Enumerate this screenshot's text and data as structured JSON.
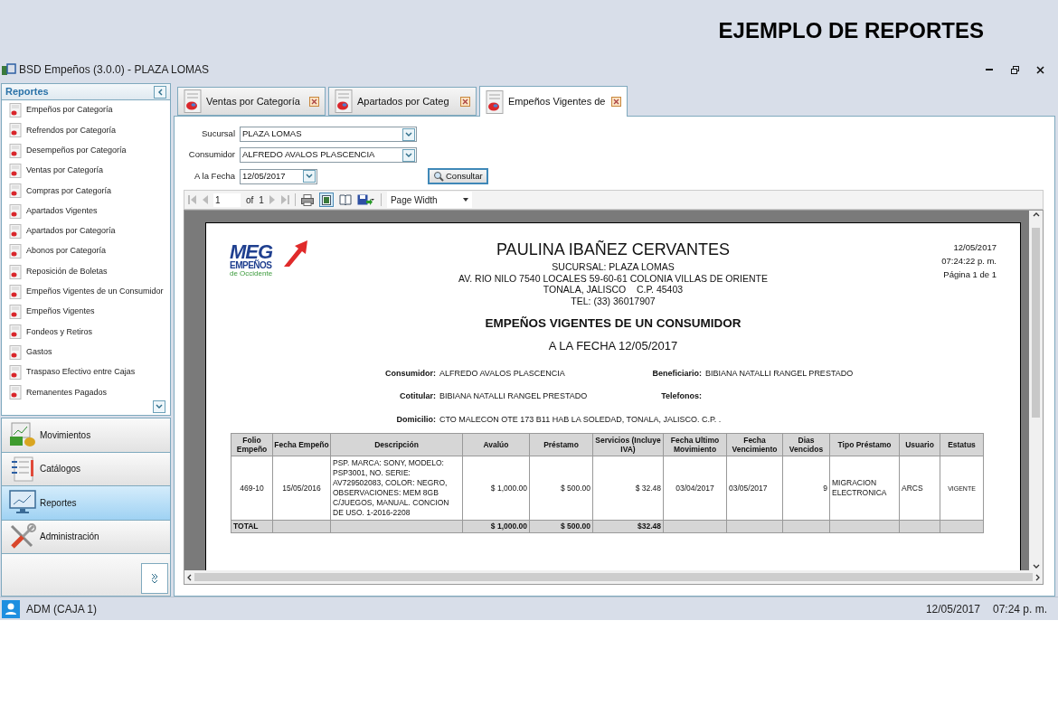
{
  "banner_title": "EJEMPLO DE REPORTES",
  "window": {
    "title": "BSD Empeños (3.0.0) - PLAZA LOMAS"
  },
  "sidebar": {
    "title": "Reportes",
    "items": [
      {
        "label": "Empeños por Categoría"
      },
      {
        "label": "Refrendos por Categoría"
      },
      {
        "label": "Desempeños por Categoría"
      },
      {
        "label": "Ventas por Categoría"
      },
      {
        "label": "Compras por Categoría"
      },
      {
        "label": "Apartados Vigentes"
      },
      {
        "label": "Apartados por Categoría"
      },
      {
        "label": "Abonos por Categoría"
      },
      {
        "label": "Reposición de Boletas"
      },
      {
        "label": "Empeños Vigentes de un Consumidor"
      },
      {
        "label": "Empeños Vigentes"
      },
      {
        "label": "Fondeos y Retiros"
      },
      {
        "label": "Gastos"
      },
      {
        "label": "Traspaso Efectivo entre Cajas"
      },
      {
        "label": "Remanentes Pagados"
      }
    ],
    "sections": [
      {
        "label": "Movimientos",
        "kind": "money",
        "selected": false
      },
      {
        "label": "Catálogos",
        "kind": "list",
        "selected": false
      },
      {
        "label": "Reportes",
        "kind": "chart",
        "selected": true
      },
      {
        "label": "Administración",
        "kind": "tools",
        "selected": false
      }
    ]
  },
  "tabs": [
    {
      "label": "Ventas por Categoría",
      "selected": false
    },
    {
      "label": "Apartados por Categ",
      "selected": false
    },
    {
      "label": "Empeños Vigentes de",
      "selected": true
    }
  ],
  "form": {
    "fields": [
      {
        "label": "Sucursal",
        "value": "PLAZA LOMAS",
        "kind": "combo"
      },
      {
        "label": "Consumidor",
        "value": "ALFREDO AVALOS PLASCENCIA",
        "kind": "combo"
      },
      {
        "label": "A la Fecha",
        "value": "12/05/2017",
        "kind": "date"
      }
    ],
    "button": "Consultar"
  },
  "toolbar": {
    "page": "1",
    "of": "of",
    "total": "1",
    "zoom": "Page Width"
  },
  "report": {
    "logo": {
      "main": "MEG",
      "sub": "EMPEÑOS",
      "tagline": "de Occidente"
    },
    "company": "PAULINA IBAÑEZ CERVANTES",
    "address": [
      "SUCURSAL: PLAZA LOMAS",
      "AV. RIO NILO 7540 LOCALES 59-60-61 COLONIA VILLAS DE ORIENTE",
      "TONALA, JALISCO    C.P. 45403",
      "TEL: (33) 36017907"
    ],
    "date": "12/05/2017",
    "time": "07:24:22 p. m.",
    "page": "Página 1 de 1",
    "title": "EMPEÑOS VIGENTES DE UN CONSUMIDOR",
    "subtitle": "A LA FECHA 12/05/2017",
    "info": [
      {
        "label": "Consumidor:",
        "value": "ALFREDO AVALOS PLASCENCIA"
      },
      {
        "label": "Beneficiario:",
        "value": "BIBIANA NATALLI RANGEL PRESTADO"
      },
      {
        "label": "Cotitular:",
        "value": "BIBIANA NATALLI RANGEL PRESTADO"
      },
      {
        "label": "Telefonos:"
      },
      {
        "label": "Domicilio:",
        "value": "CTO MALECON OTE 173 B11 HAB LA SOLEDAD, TONALA, JALISCO. C.P. ."
      }
    ],
    "table": {
      "columns": [
        "Folio Empeño",
        "Fecha Empeño",
        "Descripción",
        "Avalúo",
        "Préstamo",
        "Servicios (Incluye IVA)",
        "Fecha Ultimo Movimiento",
        "Fecha Vencimiento",
        "Dias Vencidos",
        "Tipo Préstamo",
        "Usuario",
        "Estatus"
      ],
      "rows": [
        [
          "469-10",
          "15/05/2016",
          "PSP. MARCA: SONY, MODELO: PSP3001, NO. SERIE: AV729502083, COLOR: NEGRO, OBSERVACIONES: MEM 8GB C/JUEGOS, MANUAL. CONCION DE USO. 1-2016-2208",
          "$ 1,000.00",
          "$ 500.00",
          "$ 32.48",
          "03/04/2017",
          "03/05/2017",
          "9",
          "MIGRACION ELECTRONICA",
          "ARCS",
          "VIGENTE"
        ]
      ],
      "total": {
        "label": "TOTAL",
        "values": [
          "$ 1,000.00",
          "$ 500.00",
          "$32.48"
        ]
      }
    }
  },
  "status_bar": {
    "user": "ADM (CAJA 1)",
    "date": "12/05/2017",
    "time": "07:24 p. m."
  }
}
